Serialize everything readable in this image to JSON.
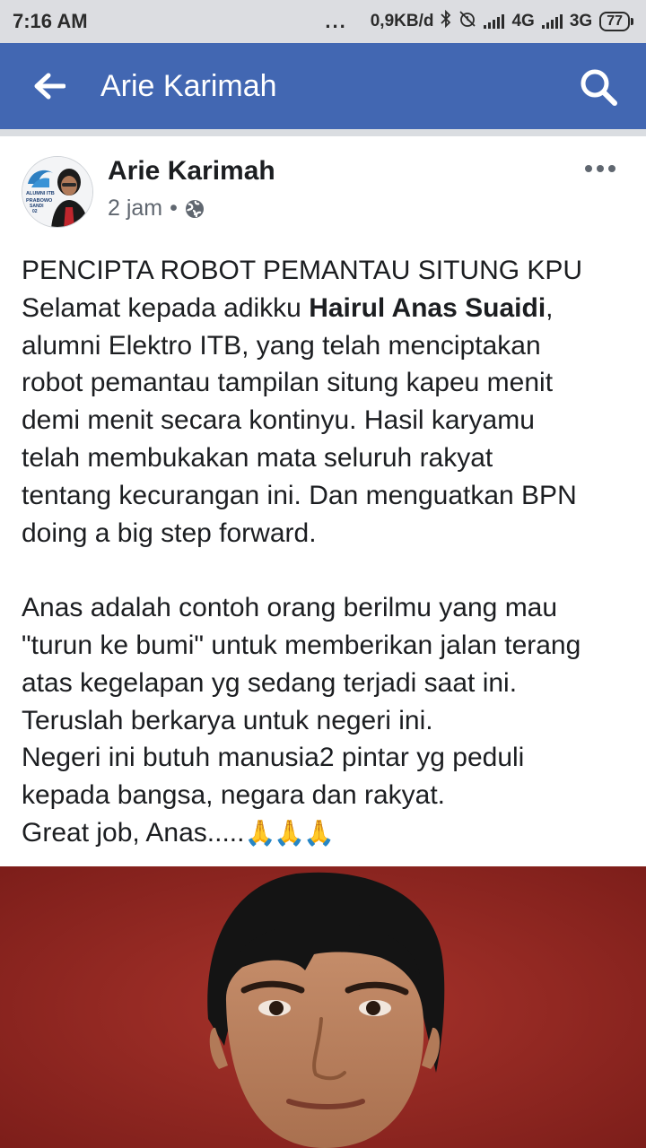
{
  "status_bar": {
    "time": "7:16 AM",
    "dots": "...",
    "speed": "0,9KB/d",
    "network_1": "4G",
    "network_2": "3G",
    "battery": "77"
  },
  "app_bar": {
    "title": "Arie Karimah",
    "color": "#4267b2"
  },
  "post": {
    "author": "Arie Karimah",
    "time": "2 jam",
    "separator": "•",
    "privacy_icon": "globe-icon",
    "avatar_text": [
      "ALUMNI ITB",
      "PRABOWO",
      "SANDI",
      "02"
    ],
    "body": {
      "line1": "PENCIPTA ROBOT PEMANTAU SITUNG KPU",
      "line2_pre": "Selamat kepada adikku ",
      "line2_bold": "Hairul Anas Suaidi",
      "line2_post": ",",
      "line3": "alumni Elektro ITB, yang telah menciptakan",
      "line4": "robot pemantau tampilan situng kapeu menit",
      "line5": "demi menit secara kontinyu. Hasil karyamu",
      "line6": "telah membukakan mata seluruh rakyat",
      "line7": "tentang kecurangan ini. Dan menguatkan BPN",
      "line8": "doing a big step forward.",
      "line9": "Anas adalah contoh orang berilmu yang mau",
      "line10": "\"turun ke bumi\" untuk memberikan jalan terang",
      "line11": "atas kegelapan yg sedang terjadi saat ini.",
      "line12": "Teruslah berkarya untuk negeri ini.",
      "line13": "Negeri ini butuh manusia2 pintar yg peduli",
      "line14": "kepada bangsa, negara dan rakyat.",
      "line15": "Great job, Anas.....",
      "line15_emoji": "🙏🙏🙏"
    }
  }
}
